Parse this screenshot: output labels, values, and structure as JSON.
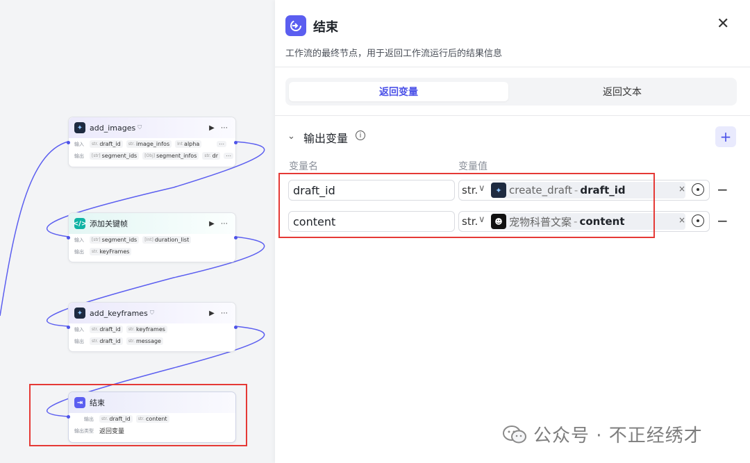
{
  "canvas": {
    "nodes": [
      {
        "id": "add_images",
        "title": "add_images",
        "badge": "⛉",
        "icon": "plugin-icon",
        "rows": [
          {
            "label": "输入",
            "chips": [
              [
                "str.",
                "draft_id"
              ],
              [
                "str.",
                "image_infos"
              ],
              [
                "Int",
                "alpha"
              ]
            ],
            "more": "⋯"
          },
          {
            "label": "输出",
            "chips": [
              [
                "[str]",
                "segment_ids"
              ],
              [
                "[Obj]",
                "segment_infos"
              ],
              [
                "str.",
                "dr"
              ]
            ],
            "more": "⋯"
          }
        ]
      },
      {
        "id": "add_keyframe_code",
        "title": "添加关键帧",
        "badge": "",
        "icon": "code-icon",
        "rows": [
          {
            "label": "输入",
            "chips": [
              [
                "[str]",
                "segment_ids"
              ],
              [
                "[Int]",
                "duration_list"
              ]
            ]
          },
          {
            "label": "输出",
            "chips": [
              [
                "str.",
                "keyFrames"
              ]
            ]
          }
        ]
      },
      {
        "id": "add_keyframes",
        "title": "add_keyframes",
        "badge": "⛉",
        "icon": "plugin-icon",
        "rows": [
          {
            "label": "输入",
            "chips": [
              [
                "str.",
                "draft_id"
              ],
              [
                "str.",
                "keyframes"
              ]
            ]
          },
          {
            "label": "输出",
            "chips": [
              [
                "str.",
                "draft_id"
              ],
              [
                "str.",
                "message"
              ]
            ]
          }
        ]
      },
      {
        "id": "end",
        "title": "结束",
        "badge": "",
        "icon": "end-icon",
        "rows": [
          {
            "label": "输出",
            "chips": [
              [
                "str.",
                "draft_id"
              ],
              [
                "str.",
                "content"
              ]
            ]
          },
          {
            "label": "输出类型",
            "text": "返回变量"
          }
        ]
      }
    ],
    "node_action_run": "▶",
    "node_action_more": "⋯"
  },
  "panel": {
    "title": "结束",
    "close": "✕",
    "description": "工作流的最终节点，用于返回工作流运行后的结果信息",
    "tabs": [
      {
        "label": "返回变量",
        "active": true
      },
      {
        "label": "返回文本",
        "active": false
      }
    ],
    "section": {
      "title": "输出变量",
      "info": "i",
      "add": "+",
      "col_name": "变量名",
      "col_value": "变量值"
    },
    "variables": [
      {
        "name": "draft_id",
        "type": "str.",
        "ref_node": "create_draft",
        "ref_sep": "-",
        "ref_var": "draft_id",
        "ref_icon": "plugin-icon",
        "clear": "×",
        "remove": "−"
      },
      {
        "name": "content",
        "type": "str.",
        "ref_node": "宠物科普文案",
        "ref_sep": "-",
        "ref_var": "content",
        "ref_icon": "llm-icon",
        "clear": "×",
        "remove": "−"
      }
    ]
  },
  "watermark": {
    "text": "公众号 · 不正经绣才"
  },
  "colors": {
    "accent": "#4d53e8",
    "highlight_border": "#e53935",
    "end_icon": "#5b5ef0"
  }
}
